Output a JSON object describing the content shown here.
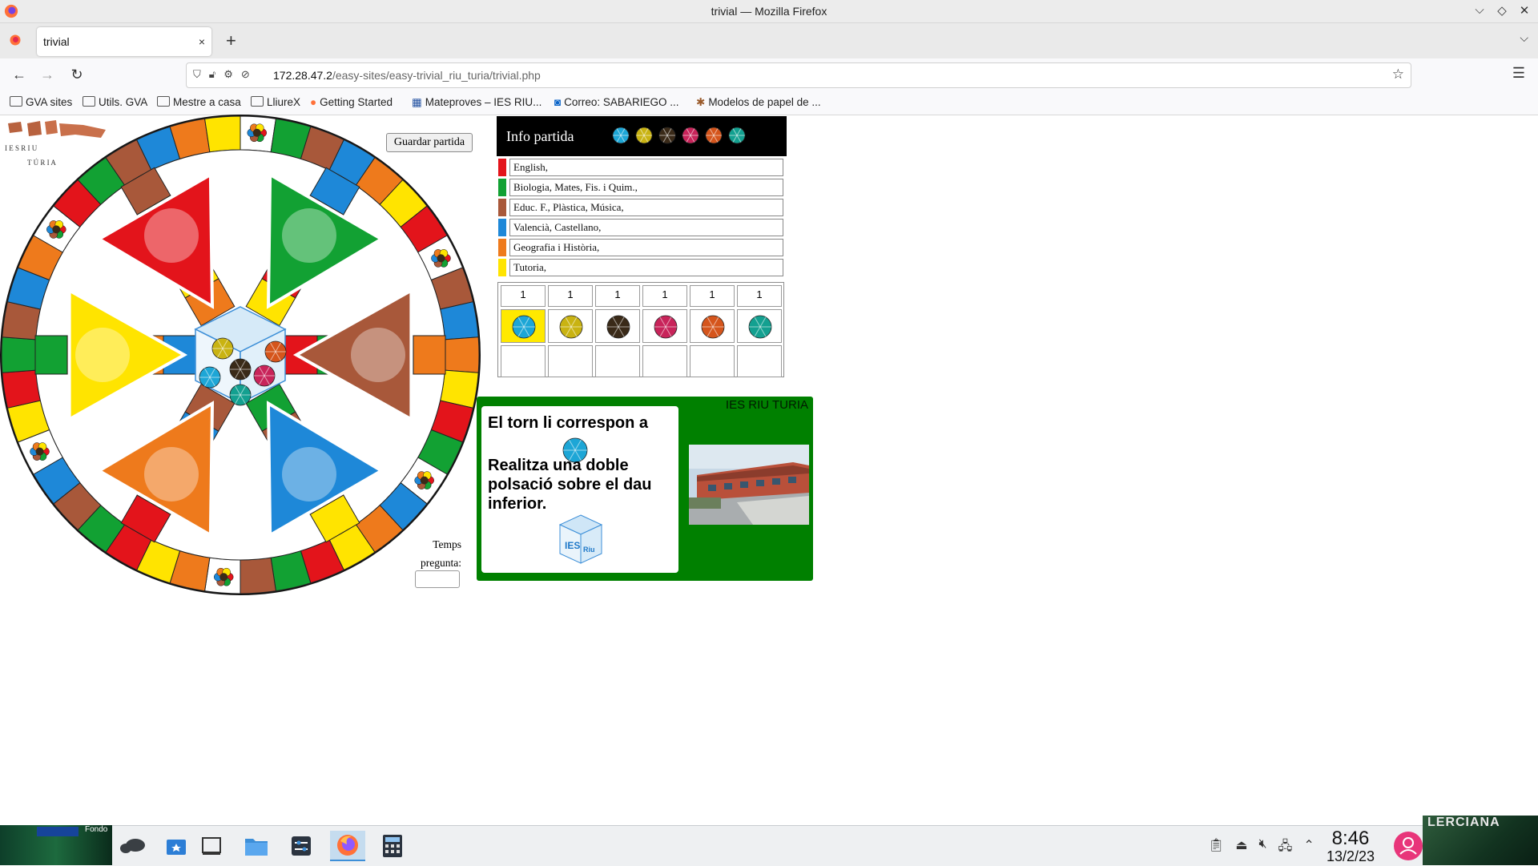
{
  "window": {
    "title": "trivial — Mozilla Firefox",
    "controls": [
      "⌵",
      "◇",
      "✕"
    ]
  },
  "tabs": [
    {
      "label": "trivial",
      "close": "×"
    }
  ],
  "newtab": "+",
  "navbar": {
    "url_host": "172.28.47.2",
    "url_path": "/easy-sites/easy-trivial_riu_turia/trivial.php"
  },
  "bookmarks": [
    {
      "label": "GVA sites",
      "icon": "folder-icon"
    },
    {
      "label": "Utils. GVA",
      "icon": "folder-icon"
    },
    {
      "label": "Mestre a casa",
      "icon": "folder-icon"
    },
    {
      "label": "LliureX",
      "icon": "folder-icon"
    },
    {
      "label": "Getting Started",
      "icon": "firefox-icon"
    },
    {
      "label": "Mateproves – IES RIU...",
      "icon": "site-icon"
    },
    {
      "label": "Correo: SABARIEGO ...",
      "icon": "outlook-icon"
    },
    {
      "label": "Modelos de papel de ...",
      "icon": "site-icon"
    }
  ],
  "logo": {
    "text_line1": "I E S R I U",
    "text_line2": "T Ú R I A"
  },
  "game": {
    "save_button": "Guardar partida",
    "temps_label_1": "Temps",
    "temps_label_2": "pregunta:",
    "temps_value": ""
  },
  "info": {
    "title": "Info partida",
    "categories": [
      {
        "label": "English,",
        "color": "#e3141b"
      },
      {
        "label": "Biologia, Mates, Fis. i Quim.,",
        "color": "#12a133"
      },
      {
        "label": "Educ. F., Plàstica, Música,",
        "color": "#a8583a"
      },
      {
        "label": "Valencià, Castellano,",
        "color": "#1e88d8"
      },
      {
        "label": "Geografia i Història,",
        "color": "#ee7a1c"
      },
      {
        "label": "Tutoria,",
        "color": "#ffe400"
      }
    ],
    "scores": [
      "1",
      "1",
      "1",
      "1",
      "1",
      "1"
    ],
    "tokens": [
      "#1da6d6",
      "#c9b312",
      "#3a2a18",
      "#c8245a",
      "#d5551c",
      "#13a090"
    ],
    "active_player": 0
  },
  "turn": {
    "heading": "El torn li correspon a",
    "instruction": "Realitza una doble polsació sobre el dau inferior.",
    "school": "IES RIU TURIA",
    "token_color": "#1da6d6"
  },
  "taskbar": {
    "apps": [
      "kde-icon",
      "app-launcher-icon",
      "desktop-icon",
      "file-manager-icon",
      "settings-icon",
      "firefox-icon",
      "calculator-icon"
    ],
    "active_app": 5,
    "time": "8:46",
    "date": "13/2/23"
  },
  "desktop": {
    "left_text": "Fondo",
    "right_text": "LERCIANA"
  }
}
